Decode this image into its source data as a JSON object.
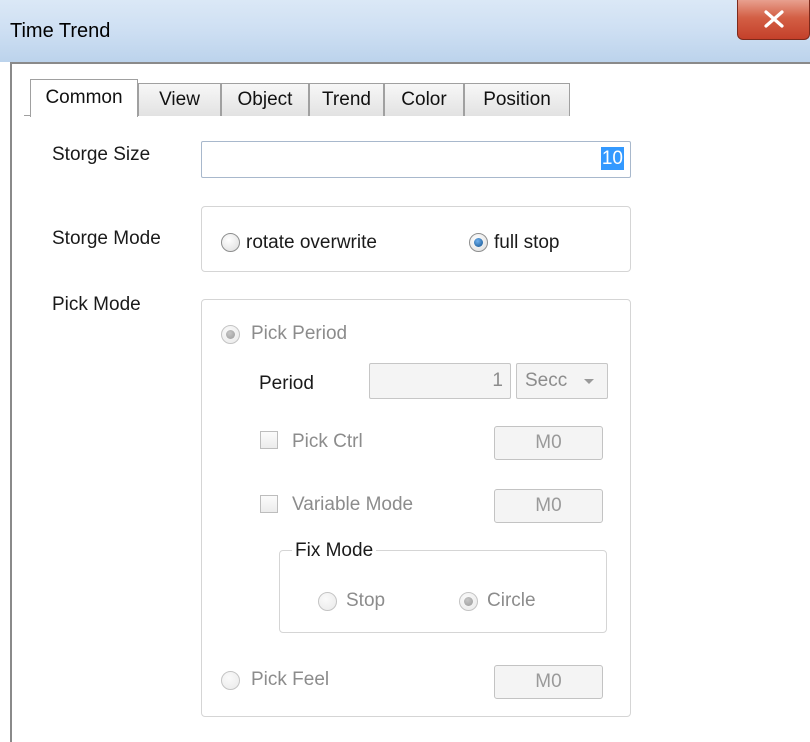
{
  "window": {
    "title": "Time Trend",
    "close_glyph": "X"
  },
  "tabs": [
    {
      "label": "Common",
      "active": true
    },
    {
      "label": "View"
    },
    {
      "label": "Object"
    },
    {
      "label": "Trend"
    },
    {
      "label": "Color"
    },
    {
      "label": "Position"
    }
  ],
  "storage_size": {
    "label": "Storge Size",
    "value": "10"
  },
  "storage_mode": {
    "label": "Storge Mode",
    "options": [
      {
        "label": "rotate overwrite",
        "checked": false
      },
      {
        "label": "full stop",
        "checked": true
      }
    ]
  },
  "pick_mode": {
    "label": "Pick Mode",
    "pick_period": {
      "label": "Pick Period",
      "checked": true,
      "enabled": false
    },
    "period": {
      "label": "Period",
      "value": "1",
      "unit": "Secc"
    },
    "pick_ctrl": {
      "label": "Pick Ctrl",
      "address": "M0"
    },
    "variable_mode": {
      "label": "Variable Mode",
      "address": "M0"
    },
    "fix_mode": {
      "label": "Fix Mode",
      "options": [
        {
          "label": "Stop",
          "checked": false
        },
        {
          "label": "Circle",
          "checked": true
        }
      ]
    },
    "pick_feel": {
      "label": "Pick Feel",
      "address": "M0"
    }
  },
  "icons": {
    "close": "close-icon",
    "dropdown": "chevron-down-icon"
  }
}
